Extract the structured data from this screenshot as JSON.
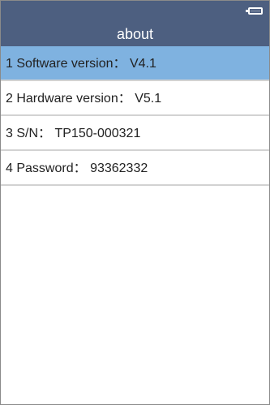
{
  "header": {
    "title": "about"
  },
  "status": {
    "battery_icon": "battery-icon"
  },
  "items": [
    {
      "label": "1 Software version：",
      "value": "V4.1"
    },
    {
      "label": "2 Hardware version：",
      "value": "V5.1"
    },
    {
      "label": "3 S/N：",
      "value": "TP150-000321"
    },
    {
      "label": "4 Password：",
      "value": "93362332"
    }
  ],
  "colors": {
    "header_bg": "#4d5f80",
    "selected_bg": "#7fb2e0",
    "divider": "#d2d2d2"
  }
}
